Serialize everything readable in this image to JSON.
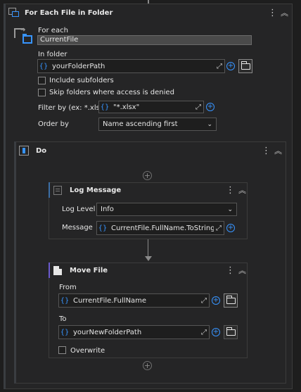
{
  "for_each": {
    "title": "For Each File in Folder",
    "for_each_label": "For each",
    "iterator_value": "CurrentFile",
    "in_folder_label": "In folder",
    "in_folder_value": "yourFolderPath",
    "include_subfolders": "Include subfolders",
    "skip_denied": "Skip folders where access is denied",
    "filter_label": "Filter by (ex: *.xlsx)",
    "filter_value": "\"*.xlsx\"",
    "order_label": "Order by",
    "order_value": "Name ascending first"
  },
  "do_block": {
    "title": "Do"
  },
  "log_message": {
    "title": "Log Message",
    "level_label": "Log Level",
    "level_value": "Info",
    "message_label": "Message",
    "message_value": "CurrentFile.FullName.ToString"
  },
  "move_file": {
    "title": "Move File",
    "from_label": "From",
    "from_value": "CurrentFile.FullName",
    "to_label": "To",
    "to_value": "yourNewFolderPath",
    "overwrite_label": "Overwrite"
  },
  "icons": {
    "brace": "{}",
    "expand": "⤢",
    "plus": "+",
    "kebab": "⋮",
    "collapse": "︽"
  },
  "colors": {
    "accent": "#3794ff",
    "background": "#1e1e1e",
    "panel": "#252526"
  }
}
